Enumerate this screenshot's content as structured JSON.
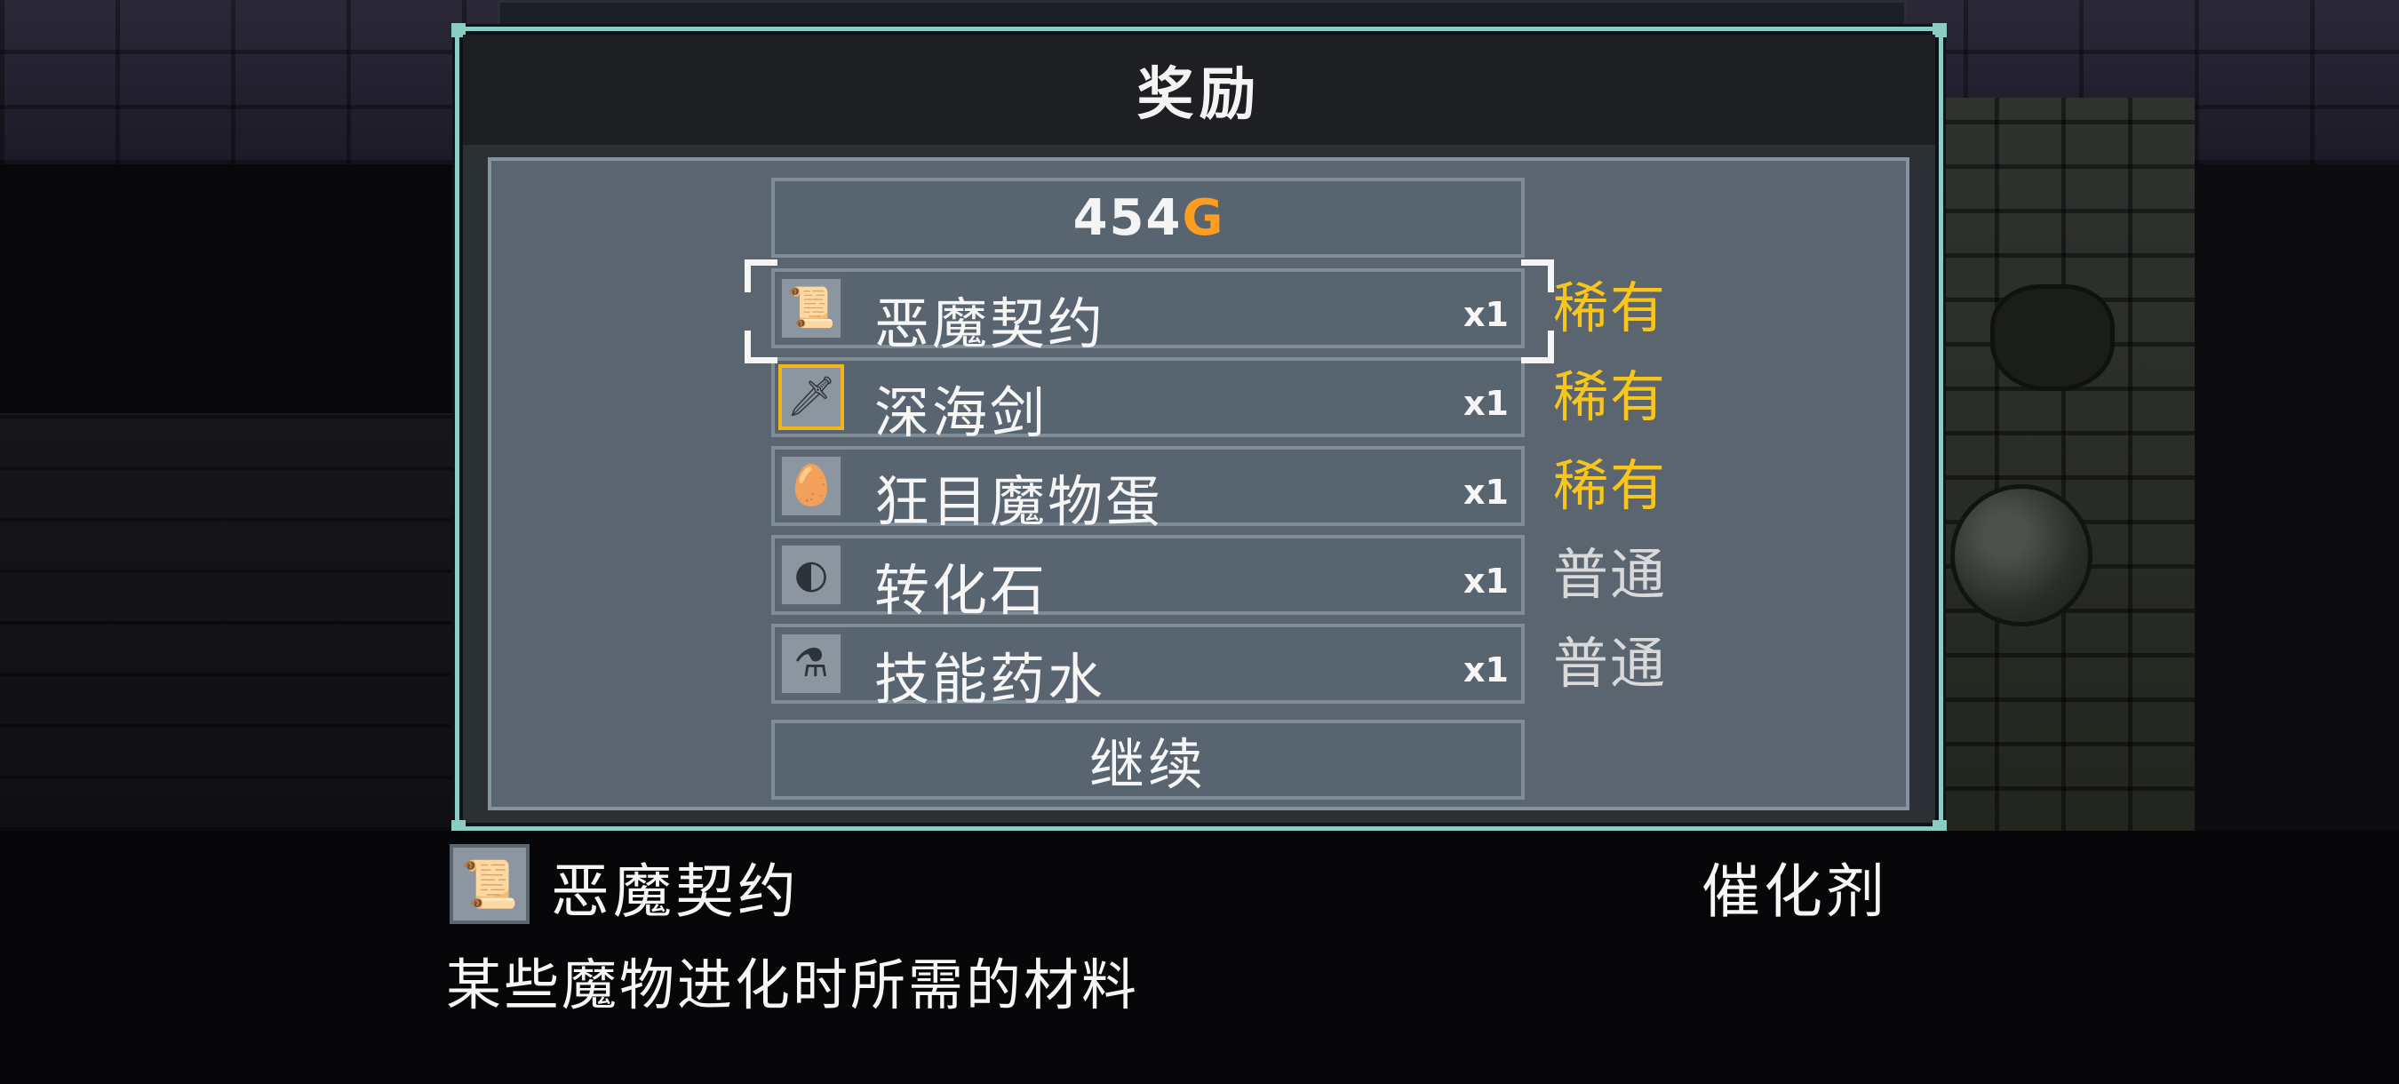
{
  "dialog": {
    "title": "奖励",
    "gold_amount": "454",
    "gold_unit": "G",
    "items": [
      {
        "icon": "scroll-icon",
        "glyph": "📜",
        "name": "恶魔契约",
        "qty": "x1",
        "rarity": "稀有",
        "rarity_color": "#f7c51c"
      },
      {
        "icon": "sword-icon",
        "glyph": "🗡",
        "name": "深海剑",
        "qty": "x1",
        "rarity": "稀有",
        "rarity_color": "#f7c51c"
      },
      {
        "icon": "egg-icon",
        "glyph": "🥚",
        "name": "狂目魔物蛋",
        "qty": "x1",
        "rarity": "稀有",
        "rarity_color": "#f7c51c"
      },
      {
        "icon": "stone-icon",
        "glyph": "◐",
        "name": "转化石",
        "qty": "x1",
        "rarity": "普通",
        "rarity_color": "#d9d9d9"
      },
      {
        "icon": "potion-icon",
        "glyph": "⚗",
        "name": "技能药水",
        "qty": "x1",
        "rarity": "普通",
        "rarity_color": "#d9d9d9"
      }
    ],
    "continue_label": "继续"
  },
  "detail": {
    "icon": "scroll-icon",
    "name": "恶魔契约",
    "category": "催化剂",
    "description": "某些魔物进化时所需的材料"
  },
  "colors": {
    "frame": "#8ccdc3",
    "gold_accent": "#ff9d1f",
    "rare": "#f7c51c",
    "common": "#d9d9d9",
    "icon_highlight": "#f2b619"
  }
}
